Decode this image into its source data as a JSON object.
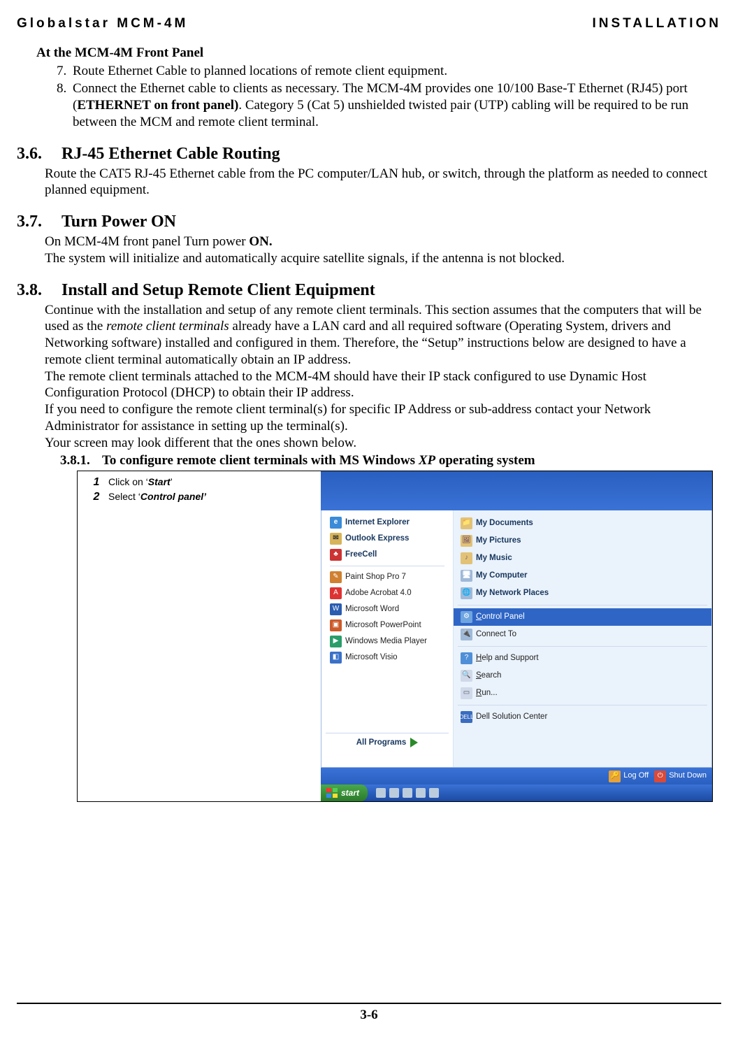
{
  "header": {
    "left": "Globalstar MCM-4M",
    "right": "INSTALLATION"
  },
  "front_panel_title": "At the MCM-4M Front Panel",
  "list_start": 7,
  "list_items": [
    "Route Ethernet Cable to planned locations of remote client equipment.",
    {
      "pre": "Connect the Ethernet cable to clients as necessary.  The MCM-4M provides one 10/100 Base-T Ethernet (RJ45) port (",
      "bold": "ETHERNET on front panel)",
      "post": ". Category 5 (Cat 5) unshielded twisted pair (UTP) cabling will be required to be run between the MCM and remote client terminal."
    }
  ],
  "s36": {
    "num": "3.6.",
    "title": "RJ-45 Ethernet Cable Routing",
    "body": "Route the CAT5 RJ-45 Ethernet cable from the PC computer/LAN hub, or switch, through the platform as needed to connect planned equipment."
  },
  "s37": {
    "num": "3.7.",
    "title": "Turn Power ON",
    "line1_pre": "On MCM-4M front panel Turn power ",
    "line1_bold": "ON.",
    "line2": "The system will initialize and automatically acquire satellite signals, if the antenna is not blocked."
  },
  "s38": {
    "num": "3.8.",
    "title": "Install and Setup Remote Client Equipment",
    "p1_pre": "Continue with the installation and setup of any remote client terminals.  This section assumes that the computers that will be used as the ",
    "p1_it": "remote client terminals",
    "p1_post": " already have a LAN card and all required software (Operating System, drivers and Networking software) installed and configured in them.  Therefore, the “Setup” instructions below are designed to have a remote client terminal automatically obtain an IP address.",
    "p2": "The remote client terminals attached to the MCM-4M should have their IP stack configured to use Dynamic Host Configuration Protocol (DHCP) to obtain their IP address.",
    "p3": "If you need to configure the remote client terminal(s) for specific IP Address or sub-address contact your Network Administrator for assistance in setting up the terminal(s).",
    "p4": "Your screen may look different that the ones shown below."
  },
  "s381": {
    "num": "3.8.1.",
    "title_pre": "To configure remote client terminals with MS Windows ",
    "title_it": "XP",
    "title_post": " operating system"
  },
  "steps": [
    {
      "n": "1",
      "pre": "Click on ‘",
      "bold": "Start",
      "post": "’"
    },
    {
      "n": "2",
      "pre": "Select  ‘",
      "bold": "Control panel’",
      "post": ""
    }
  ],
  "startmenu": {
    "pinned": [
      "Internet Explorer",
      "Outlook Express",
      "FreeCell"
    ],
    "recent": [
      "Paint Shop Pro 7",
      "Adobe Acrobat 4.0",
      "Microsoft Word",
      "Microsoft PowerPoint",
      "Windows Media Player",
      "Microsoft Visio"
    ],
    "all_programs": "All Programs",
    "places_top": [
      "My Documents",
      "My Pictures",
      "My Music",
      "My Computer",
      "My Network Places"
    ],
    "system": [
      "Control Panel",
      "Connect To",
      "Help and Support",
      "Search",
      "Run..."
    ],
    "oem": "Dell Solution Center",
    "logoff": "Log Off",
    "shutdown": "Shut Down",
    "start": "start"
  },
  "page_number": "3-6"
}
